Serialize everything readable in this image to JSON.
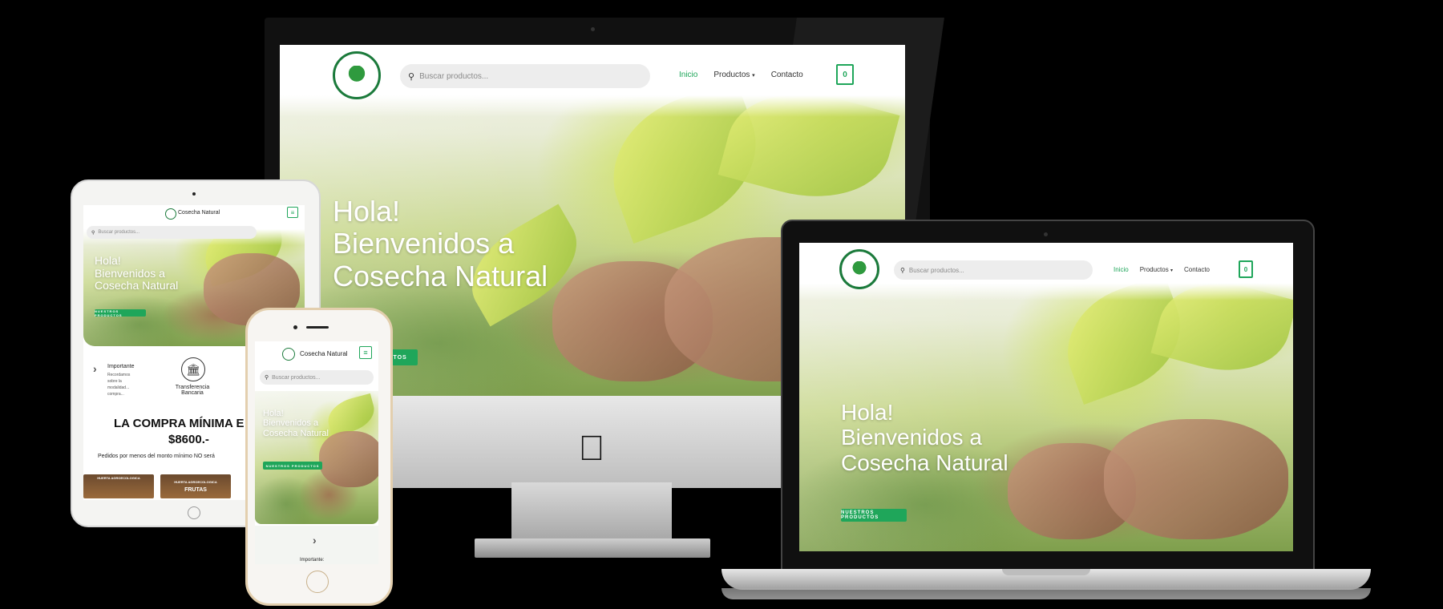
{
  "site": {
    "brand": "Cosecha Natural",
    "logo_text": "Cosecha natural",
    "search_placeholder": "Buscar productos...",
    "nav": {
      "home": "Inicio",
      "products": "Productos",
      "contact": "Contacto"
    },
    "cart_count": "0",
    "hero": {
      "line1": "Hola!",
      "line2": "Bienvenidos a",
      "line3": "Cosecha Natural"
    },
    "cta": "Nuestros productos",
    "colors": {
      "accent": "#1fa65a",
      "dark_green": "#1b7a3b"
    }
  },
  "imac_cta_visible": "DUCTOS",
  "info": {
    "important_title": "Importante",
    "important_lines": [
      "Recordamos",
      "sobre la",
      "modalidad...",
      "compra..."
    ],
    "transfer": "Transferencia Bancaria",
    "min_purchase": "LA COMPRA MÍNIMA E",
    "min_amount": "$8600.-",
    "below_min": "Pedidos por menos del monto mínimo NO será",
    "card1_banner": "HUERTA AGROECOLOGICA",
    "card2_banner": "HUERTA AGROECOLOGICA",
    "card2_label": "FRUTAS"
  },
  "phone_info": {
    "important_title": "Importante:"
  },
  "icons": {
    "search": "search-icon",
    "chevron": "chevron-right-icon",
    "bank": "bank-icon",
    "menu": "menu-icon",
    "cart": "cart-icon",
    "apple": "apple-logo-icon"
  }
}
